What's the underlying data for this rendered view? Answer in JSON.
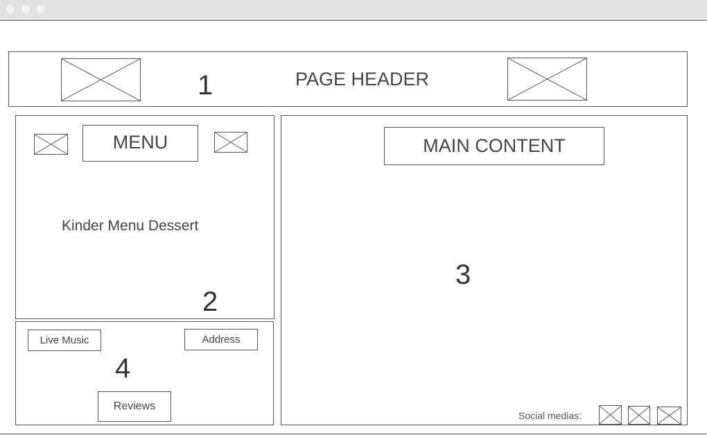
{
  "header": {
    "title": "PAGE HEADER",
    "region_number": "1"
  },
  "menu_panel": {
    "title": "MENU",
    "items_text": "Kinder Menu Dessert",
    "region_number": "2"
  },
  "main_content": {
    "title": "MAIN CONTENT",
    "region_number": "3",
    "social_label": "Social medias:"
  },
  "info_panel": {
    "region_number": "4",
    "live_music_label": "Live Music",
    "address_label": "Address",
    "reviews_label": "Reviews"
  },
  "colors": {
    "border": "#555555",
    "titlebar": "#e2e2e2",
    "text": "#333333"
  }
}
